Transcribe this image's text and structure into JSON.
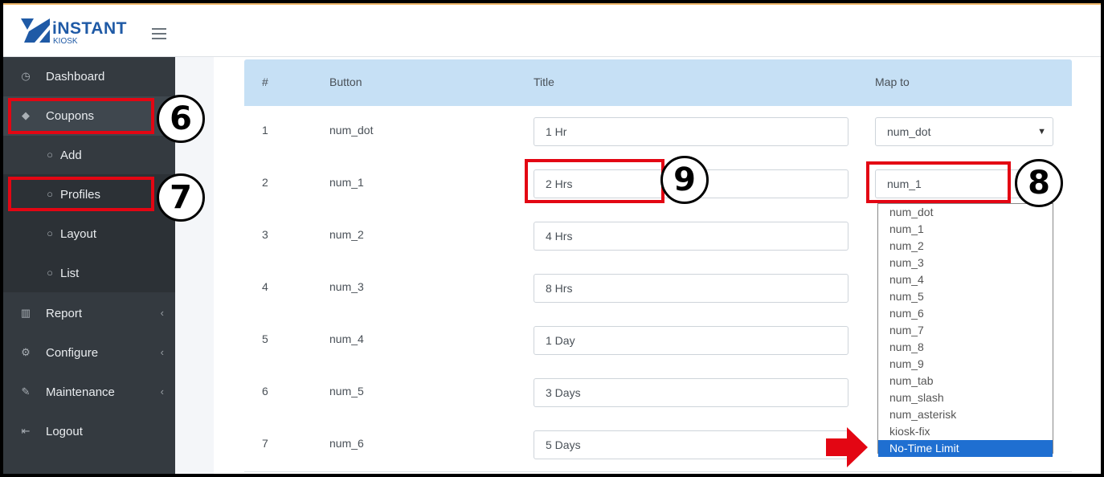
{
  "brand": {
    "name": "iNSTANT",
    "sub": "KIOSK"
  },
  "sidebar": {
    "items": [
      {
        "label": "Dashboard",
        "icon": "speedometer-icon"
      },
      {
        "label": "Coupons",
        "icon": "tag-icon"
      },
      {
        "label": "Add",
        "icon": "circle-icon"
      },
      {
        "label": "Profiles",
        "icon": "circle-icon"
      },
      {
        "label": "Layout",
        "icon": "circle-icon"
      },
      {
        "label": "List",
        "icon": "circle-icon"
      },
      {
        "label": "Report",
        "icon": "bar-chart-icon"
      },
      {
        "label": "Configure",
        "icon": "gear-icon"
      },
      {
        "label": "Maintenance",
        "icon": "wrench-icon"
      },
      {
        "label": "Logout",
        "icon": "logout-icon"
      }
    ]
  },
  "table": {
    "headers": [
      "#",
      "Button",
      "Title",
      "Map to"
    ],
    "rows": [
      {
        "num": "1",
        "button": "num_dot",
        "title": "1 Hr",
        "map": "num_dot"
      },
      {
        "num": "2",
        "button": "num_1",
        "title": "2 Hrs",
        "map": "num_1"
      },
      {
        "num": "3",
        "button": "num_2",
        "title": "4 Hrs"
      },
      {
        "num": "4",
        "button": "num_3",
        "title": "8 Hrs"
      },
      {
        "num": "5",
        "button": "num_4",
        "title": "1 Day"
      },
      {
        "num": "6",
        "button": "num_5",
        "title": "3 Days"
      },
      {
        "num": "7",
        "button": "num_6",
        "title": "5 Days"
      }
    ]
  },
  "dropdown": {
    "options": [
      "num_dot",
      "num_1",
      "num_2",
      "num_3",
      "num_4",
      "num_5",
      "num_6",
      "num_7",
      "num_8",
      "num_9",
      "num_tab",
      "num_slash",
      "num_asterisk",
      "kiosk-fix",
      "No-Time Limit"
    ],
    "highlighted": "No-Time Limit"
  },
  "callouts": [
    "6",
    "7",
    "8",
    "9"
  ],
  "colors": {
    "accent_red": "#e30613",
    "sidebar_bg": "#343a40",
    "header_row": "#c6e0f5",
    "selected_option": "#1f6fd1"
  }
}
